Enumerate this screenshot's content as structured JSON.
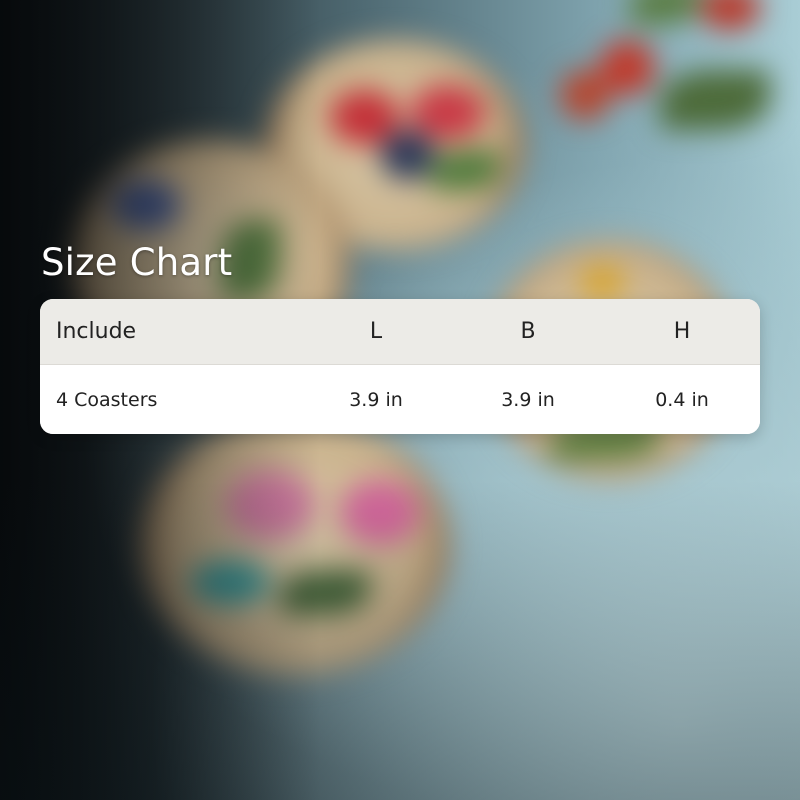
{
  "size_chart": {
    "title": "Size Chart",
    "columns": [
      "Include",
      "L",
      "B",
      "H"
    ],
    "rows": [
      [
        "4 Coasters",
        "3.9 in",
        "3.9 in",
        "0.4 in"
      ]
    ]
  },
  "colors": {
    "title_text": "#ffffff",
    "header_bg": "#ecebe7",
    "row_bg": "#ffffff",
    "cell_text": "#222222"
  }
}
